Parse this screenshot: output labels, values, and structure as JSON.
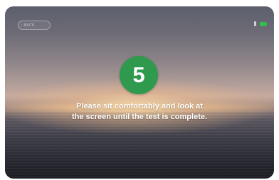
{
  "header": {
    "back_label": "BACK",
    "back_icon": "chevron-left-icon"
  },
  "status": {
    "mic_icon": "microphone-icon",
    "battery_icon": "battery-icon",
    "battery_color": "#2fbf4f"
  },
  "countdown": {
    "value": "5",
    "color": "#2f9a4d"
  },
  "instruction": {
    "line1": "Please sit comfortably and look at",
    "line2": "the screen until the test is complete."
  }
}
